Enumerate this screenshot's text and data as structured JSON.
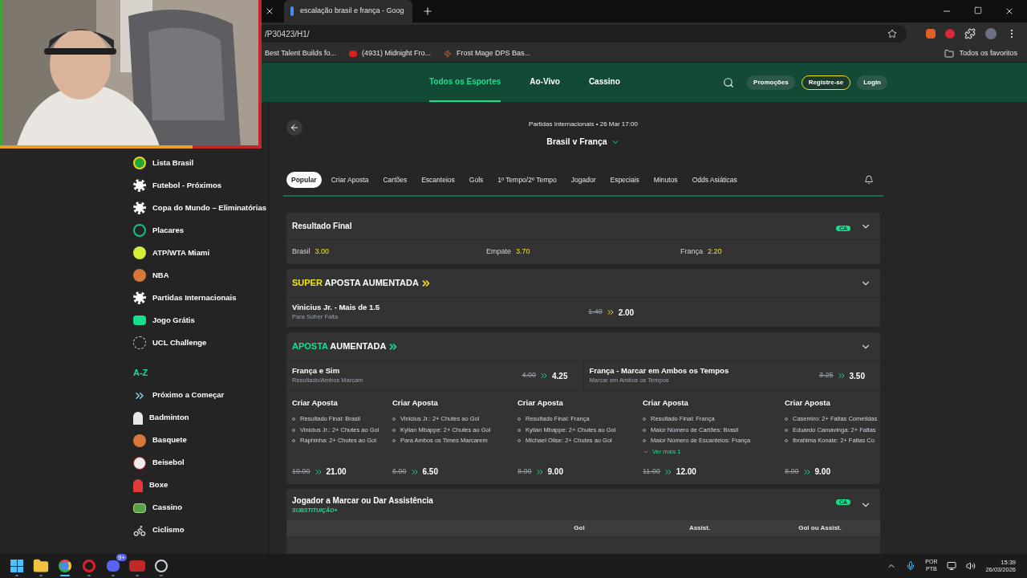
{
  "browser": {
    "tabs": [
      {
        "title": "escalação brasil e frança - Goog",
        "selected": true
      }
    ],
    "address": "/P30423/H1/",
    "bookmarks": [
      {
        "label": "Best Talent Builds fo...",
        "kind": "page"
      },
      {
        "label": "(4931) Midnight Fro...",
        "kind": "video"
      },
      {
        "label": "Frost Mage DPS Bas...",
        "kind": "wand"
      }
    ],
    "favorites": "Todos os favoritos"
  },
  "header": {
    "nav": [
      {
        "label": "Todos os Esportes",
        "selected": true
      },
      {
        "label": "Ao-Vivo",
        "selected": false
      },
      {
        "label": "Cassino",
        "selected": false
      }
    ],
    "buttons": [
      {
        "label": "Promoções",
        "kind": "plain"
      },
      {
        "label": "Registre-se",
        "kind": "outlined"
      },
      {
        "label": "Login",
        "kind": "plain"
      }
    ]
  },
  "sidebar": {
    "items": [
      {
        "label": "Lista Brasil",
        "kind": "brazil"
      },
      {
        "label": "Futebol - Próximos",
        "kind": "soccer"
      },
      {
        "label": "Copa do Mundo – Eliminatórias",
        "kind": "soccer"
      },
      {
        "label": "Placares",
        "kind": "six"
      },
      {
        "label": "ATP/WTA Miami",
        "kind": "tennis"
      },
      {
        "label": "NBA",
        "kind": "basketball"
      },
      {
        "label": "Partidas Internacionais",
        "kind": "soccer"
      },
      {
        "label": "Jogo Grátis",
        "kind": "free"
      },
      {
        "label": "UCL Challenge",
        "kind": "ucl"
      }
    ],
    "section": "A-Z",
    "az_items": [
      {
        "label": "Próximo a Começar",
        "kind": "arrow"
      },
      {
        "label": "Badminton",
        "kind": "badminton"
      },
      {
        "label": "Basquete",
        "kind": "basketball"
      },
      {
        "label": "Beisebol",
        "kind": "baseball"
      },
      {
        "label": "Boxe",
        "kind": "boxing"
      },
      {
        "label": "Cassino",
        "kind": "casino"
      },
      {
        "label": "Ciclismo",
        "kind": "cycling"
      }
    ]
  },
  "event": {
    "competition": "Partidas Internacionais • 26 Mar 17:00",
    "title": "Brasil v França",
    "tabs": [
      {
        "label": "Popular",
        "selected": true
      },
      {
        "label": "Criar Aposta",
        "selected": false
      },
      {
        "label": "Cartões",
        "selected": false
      },
      {
        "label": "Escanteios",
        "selected": false
      },
      {
        "label": "Gols",
        "selected": false
      },
      {
        "label": "1º Tempo/2º Tempo",
        "selected": false
      },
      {
        "label": "Jogador",
        "selected": false
      },
      {
        "label": "Especiais",
        "selected": false
      },
      {
        "label": "Minutos",
        "selected": false
      },
      {
        "label": "Odds Asiáticas",
        "selected": false
      }
    ]
  },
  "markets": [
    {
      "kind": "three-way",
      "title": "Resultado Final",
      "badge": "CA",
      "outcomes": [
        {
          "label": "Brasil",
          "odds": "3.00"
        },
        {
          "label": "Empate",
          "odds": "3.70"
        },
        {
          "label": "França",
          "odds": "2.20"
        }
      ]
    },
    {
      "kind": "boost",
      "highlight": "SUPER",
      "title": "APOSTA AUMENTADA",
      "color": "#f2e21b",
      "selections": [
        {
          "name": "Vinicius Jr. - Mais de 1.5",
          "sub": "Para Sofrer Falta",
          "old": "1.40",
          "new": "2.00"
        }
      ]
    },
    {
      "kind": "boost",
      "highlight": "APOSTA",
      "title": "AUMENTADA",
      "color": "#14e08e",
      "selections": [
        {
          "name": "França e Sim",
          "sub": "Resultado/Ambos Marcam",
          "old": "4.00",
          "new": "4.25"
        },
        {
          "name": "França - Marcar em Ambos os Tempos",
          "sub": "Marcar em Ambos os Tempos",
          "old": "3.25",
          "new": "3.50"
        }
      ],
      "builders": [
        {
          "title": "Criar Aposta",
          "legs": [
            "Resultado Final: Brasil",
            "Vinicius Jr.: 2+ Chutes ao Gol",
            "Raphinha: 2+ Chutes ao Gol"
          ],
          "old": "19.00",
          "new": "21.00"
        },
        {
          "title": "Criar Aposta",
          "legs": [
            "Vinicius Jr.: 2+ Chutes ao Gol",
            "Kylian Mbappe: 2+ Chutes ao Gol",
            "Para Ambos os Times Marcarem"
          ],
          "old": "6.00",
          "new": "6.50"
        },
        {
          "title": "Criar Aposta",
          "legs": [
            "Resultado Final: França",
            "Kylian Mbappe: 2+ Chutes ao Gol",
            "Michael Olise: 2+ Chutes ao Gol"
          ],
          "old": "8.00",
          "new": "9.00"
        },
        {
          "title": "Criar Aposta",
          "legs": [
            "Resultado Final: França",
            "Maior Número de Cartões: Brasil",
            "Maior Número de Escanteios: França"
          ],
          "more": "Ver mais 1",
          "old": "11.00",
          "new": "12.00"
        },
        {
          "title": "Criar Aposta",
          "legs": [
            "Casemiro: 2+ Faltas Cometidas",
            "Eduardo Camavinga: 2+ Faltas",
            "Ibrahima Konate: 2+ Faltas Co"
          ],
          "old": "8.00",
          "new": "9.00"
        }
      ]
    },
    {
      "kind": "player",
      "title": "Jogador a Marcar ou Dar Assistência",
      "subtitle": "SUBSTITUIÇÃO+",
      "badge": "CA",
      "columns": [
        "Gol",
        "Assist.",
        "Gol ou Assist."
      ]
    }
  ],
  "taskbar": {
    "apps": [
      {
        "kind": "windows",
        "selected": false
      },
      {
        "kind": "folder",
        "selected": false
      },
      {
        "kind": "chrome",
        "selected": true
      },
      {
        "kind": "opera",
        "selected": false
      },
      {
        "kind": "discord",
        "selected": false,
        "badge": "9+"
      },
      {
        "kind": "mixer",
        "selected": false
      },
      {
        "kind": "obs",
        "selected": false
      }
    ],
    "language": "POR",
    "layout": "PTB",
    "time": "15:39",
    "date": "26/03/2026"
  }
}
